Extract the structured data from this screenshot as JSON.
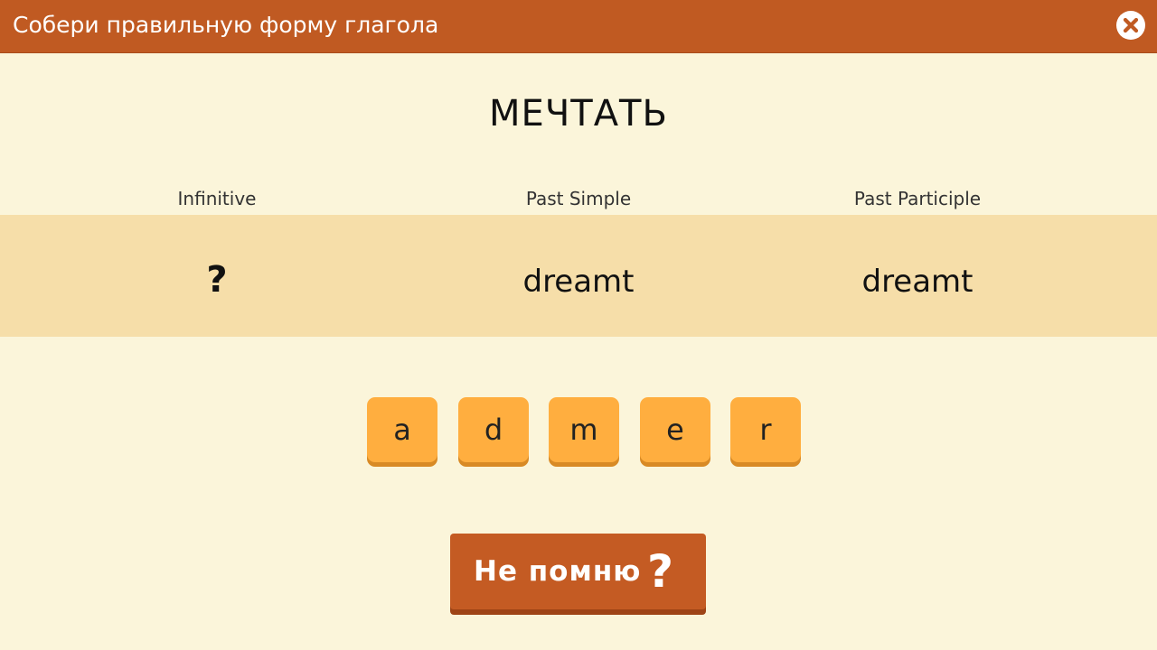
{
  "header": {
    "title": "Собери правильную форму глагола",
    "close_icon": "close-icon"
  },
  "verb": {
    "word": "МЕЧТАТЬ"
  },
  "table": {
    "columns": [
      "Infinitive",
      "Past Simple",
      "Past Participle"
    ],
    "values": [
      "?",
      "dreamt",
      "dreamt"
    ]
  },
  "letters": [
    "a",
    "d",
    "m",
    "e",
    "r"
  ],
  "hint_button": {
    "label": "Не помню",
    "icon_glyph": "?",
    "icon": "question-mark-icon"
  },
  "colors": {
    "header": "#c05a22",
    "background": "#fbf5da",
    "band": "#f6dea9",
    "tile": "#ffae3f",
    "button": "#c45b23"
  }
}
